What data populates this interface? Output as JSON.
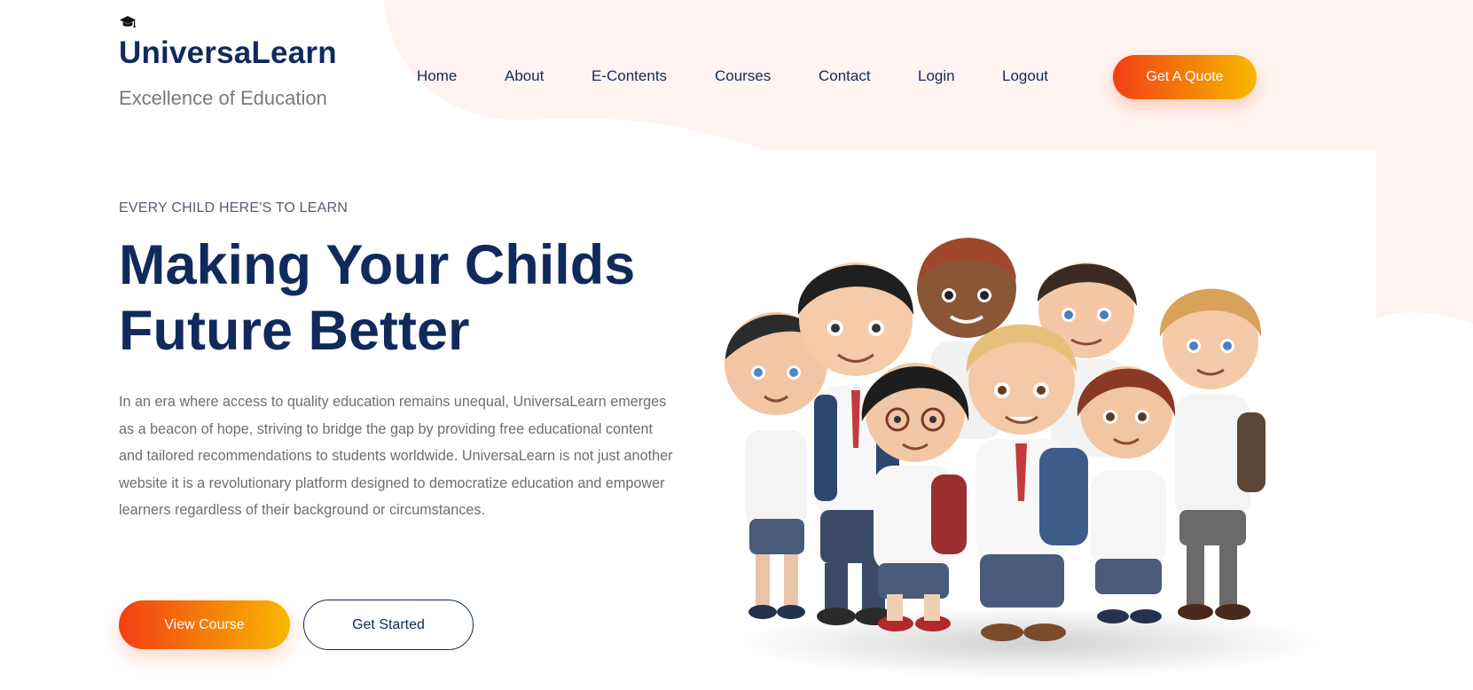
{
  "brand": {
    "name": "UniversaLearn",
    "tagline": "Excellence of Education"
  },
  "nav": {
    "items": [
      "Home",
      "About",
      "E-Contents",
      "Courses",
      "Contact",
      "Login",
      "Logout"
    ]
  },
  "header_cta": "Get A Quote",
  "hero": {
    "eyebrow": "EVERY CHILD HERE'S TO LEARN",
    "headline_line1": "Making Your Childs",
    "headline_line2": "Future Better",
    "description": "In an era where access to quality education remains unequal, UniversaLearn emerges as a beacon of hope, striving to bridge the gap by providing free educational content and tailored recommendations to students worldwide. UniversaLearn is not just another website it is a revolutionary platform designed to democratize education and empower learners regardless of their background or circumstances.",
    "primary_button": "View Course",
    "secondary_button": "Get Started"
  },
  "colors": {
    "navy": "#102a5c",
    "accent_start": "#f23f14",
    "accent_end": "#f7b800",
    "blob": "#fff4f1"
  },
  "icons": {
    "brand": "graduation-cap-icon"
  }
}
